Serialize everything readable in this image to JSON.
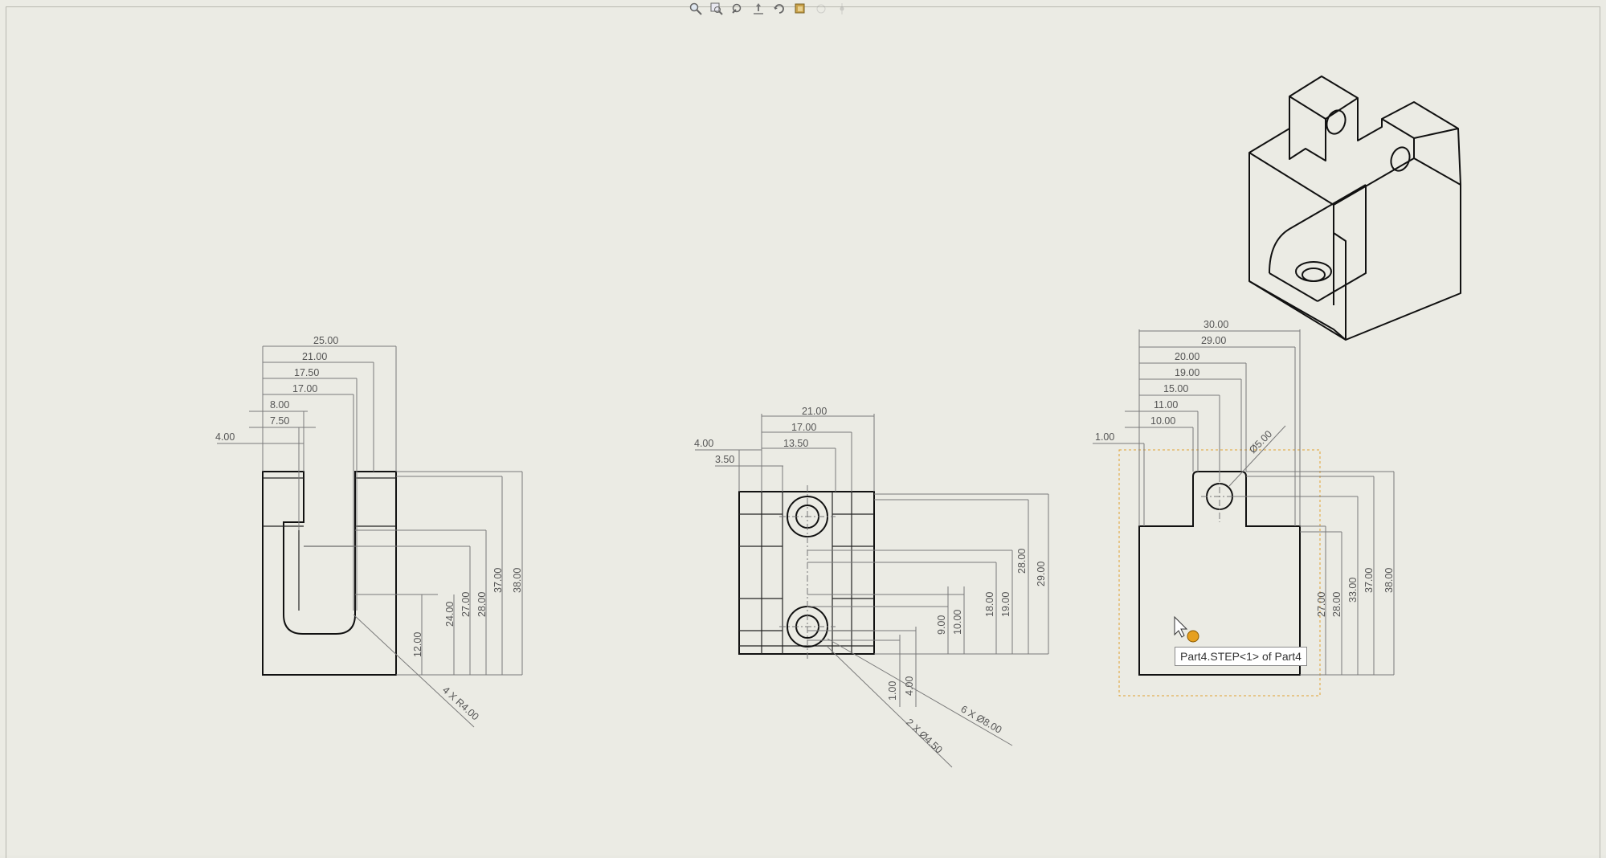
{
  "toolbar": {
    "icons": [
      "zoom-to-fit-icon",
      "zoom-area-icon",
      "previous-view-icon",
      "pan-icon",
      "rotate-icon",
      "display-style-icon",
      "hide-show-icon",
      "view-settings-icon"
    ]
  },
  "views": {
    "left": {
      "horiz_dims": [
        "25.00",
        "21.00",
        "17.50",
        "17.00",
        "8.00",
        "7.50",
        "4.00"
      ],
      "vert_dims": [
        "12.00",
        "24.00",
        "27.00",
        "28.00",
        "37.00",
        "38.00"
      ],
      "radius_note": "4 X R4.00"
    },
    "middle": {
      "horiz_dims": [
        "21.00",
        "17.00",
        "13.50",
        "4.00",
        "3.50"
      ],
      "vert_dims": [
        "1.00",
        "4.00",
        "9.00",
        "10.00",
        "18.00",
        "19.00",
        "28.00",
        "29.00"
      ],
      "hole_note_1": "6 X Ø8.00",
      "hole_note_2": "2 X Ø4.50"
    },
    "right": {
      "horiz_dims": [
        "30.00",
        "29.00",
        "20.00",
        "19.00",
        "15.00",
        "11.00",
        "10.00",
        "1.00"
      ],
      "vert_dims": [
        "27.00",
        "28.00",
        "33.00",
        "37.00",
        "38.00"
      ],
      "hole_note": "Ø5.00"
    }
  },
  "tooltip": {
    "text": "Part4.STEP<1> of Part4"
  }
}
